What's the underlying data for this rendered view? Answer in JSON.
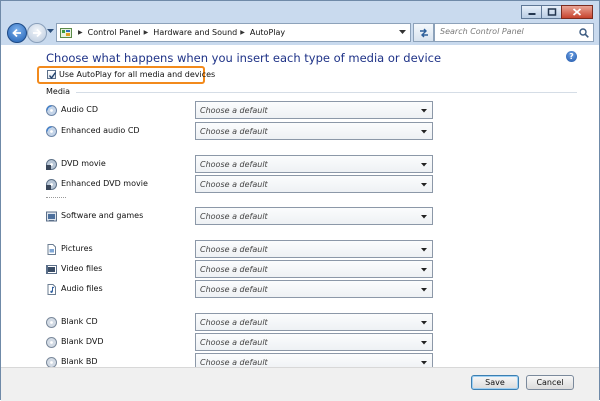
{
  "nav": {
    "breadcrumb": [
      "Control Panel",
      "Hardware and Sound",
      "AutoPlay"
    ],
    "search_placeholder": "Search Control Panel"
  },
  "main": {
    "heading": "Choose what happens when you insert each type of media or device",
    "autoplay_checkbox": {
      "label": "Use AutoPlay for all media and devices",
      "checked": true
    },
    "group_label": "Media",
    "rows": [
      {
        "label": "Audio CD",
        "icon": "cd-icon",
        "value": "Choose a default"
      },
      {
        "label": "Enhanced audio CD",
        "icon": "cd-icon",
        "value": "Choose a default"
      },
      {
        "label": "DVD movie",
        "icon": "dvd-icon",
        "value": "Choose a default"
      },
      {
        "label": "Enhanced DVD movie",
        "icon": "dvd-icon",
        "value": "Choose a default"
      },
      {
        "label": "Software and games",
        "icon": "software-icon",
        "value": "Choose a default"
      },
      {
        "label": "Pictures",
        "icon": "picture-file-icon",
        "value": "Choose a default"
      },
      {
        "label": "Video files",
        "icon": "video-file-icon",
        "value": "Choose a default"
      },
      {
        "label": "Audio files",
        "icon": "audio-file-icon",
        "value": "Choose a default"
      },
      {
        "label": "Blank CD",
        "icon": "blank-disc-icon",
        "value": "Choose a default"
      },
      {
        "label": "Blank DVD",
        "icon": "blank-disc-icon",
        "value": "Choose a default"
      },
      {
        "label": "Blank BD",
        "icon": "blank-disc-icon",
        "value": "Choose a default"
      }
    ]
  },
  "footer": {
    "save_label": "Save",
    "cancel_label": "Cancel"
  },
  "colors": {
    "highlight": "#f28a1c",
    "heading": "#1e3287",
    "window_frame": "#c9daee"
  }
}
